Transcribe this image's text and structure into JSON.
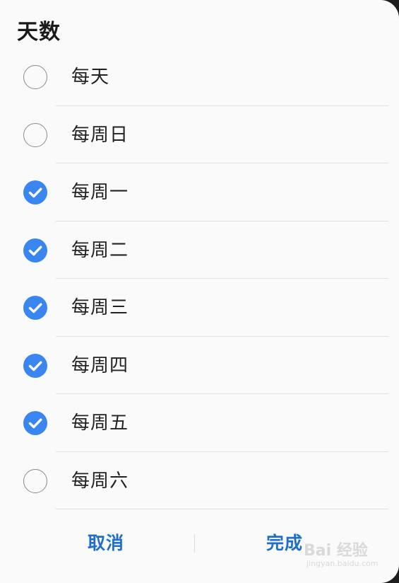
{
  "dialog": {
    "title": "天数"
  },
  "options": [
    {
      "label": "每天",
      "checked": false
    },
    {
      "label": "每周日",
      "checked": false
    },
    {
      "label": "每周一",
      "checked": true
    },
    {
      "label": "每周二",
      "checked": true
    },
    {
      "label": "每周三",
      "checked": true
    },
    {
      "label": "每周四",
      "checked": true
    },
    {
      "label": "每周五",
      "checked": true
    },
    {
      "label": "每周六",
      "checked": false
    }
  ],
  "footer": {
    "cancel_label": "取消",
    "done_label": "完成"
  },
  "watermark": {
    "text": "Bai 经验",
    "subtext": "jingyan.baidu.com"
  },
  "colors": {
    "accent": "#3a86f0",
    "button_text": "#1f6fc8"
  },
  "icons": {
    "checked": "check-circle-icon",
    "unchecked": "empty-circle-icon"
  }
}
